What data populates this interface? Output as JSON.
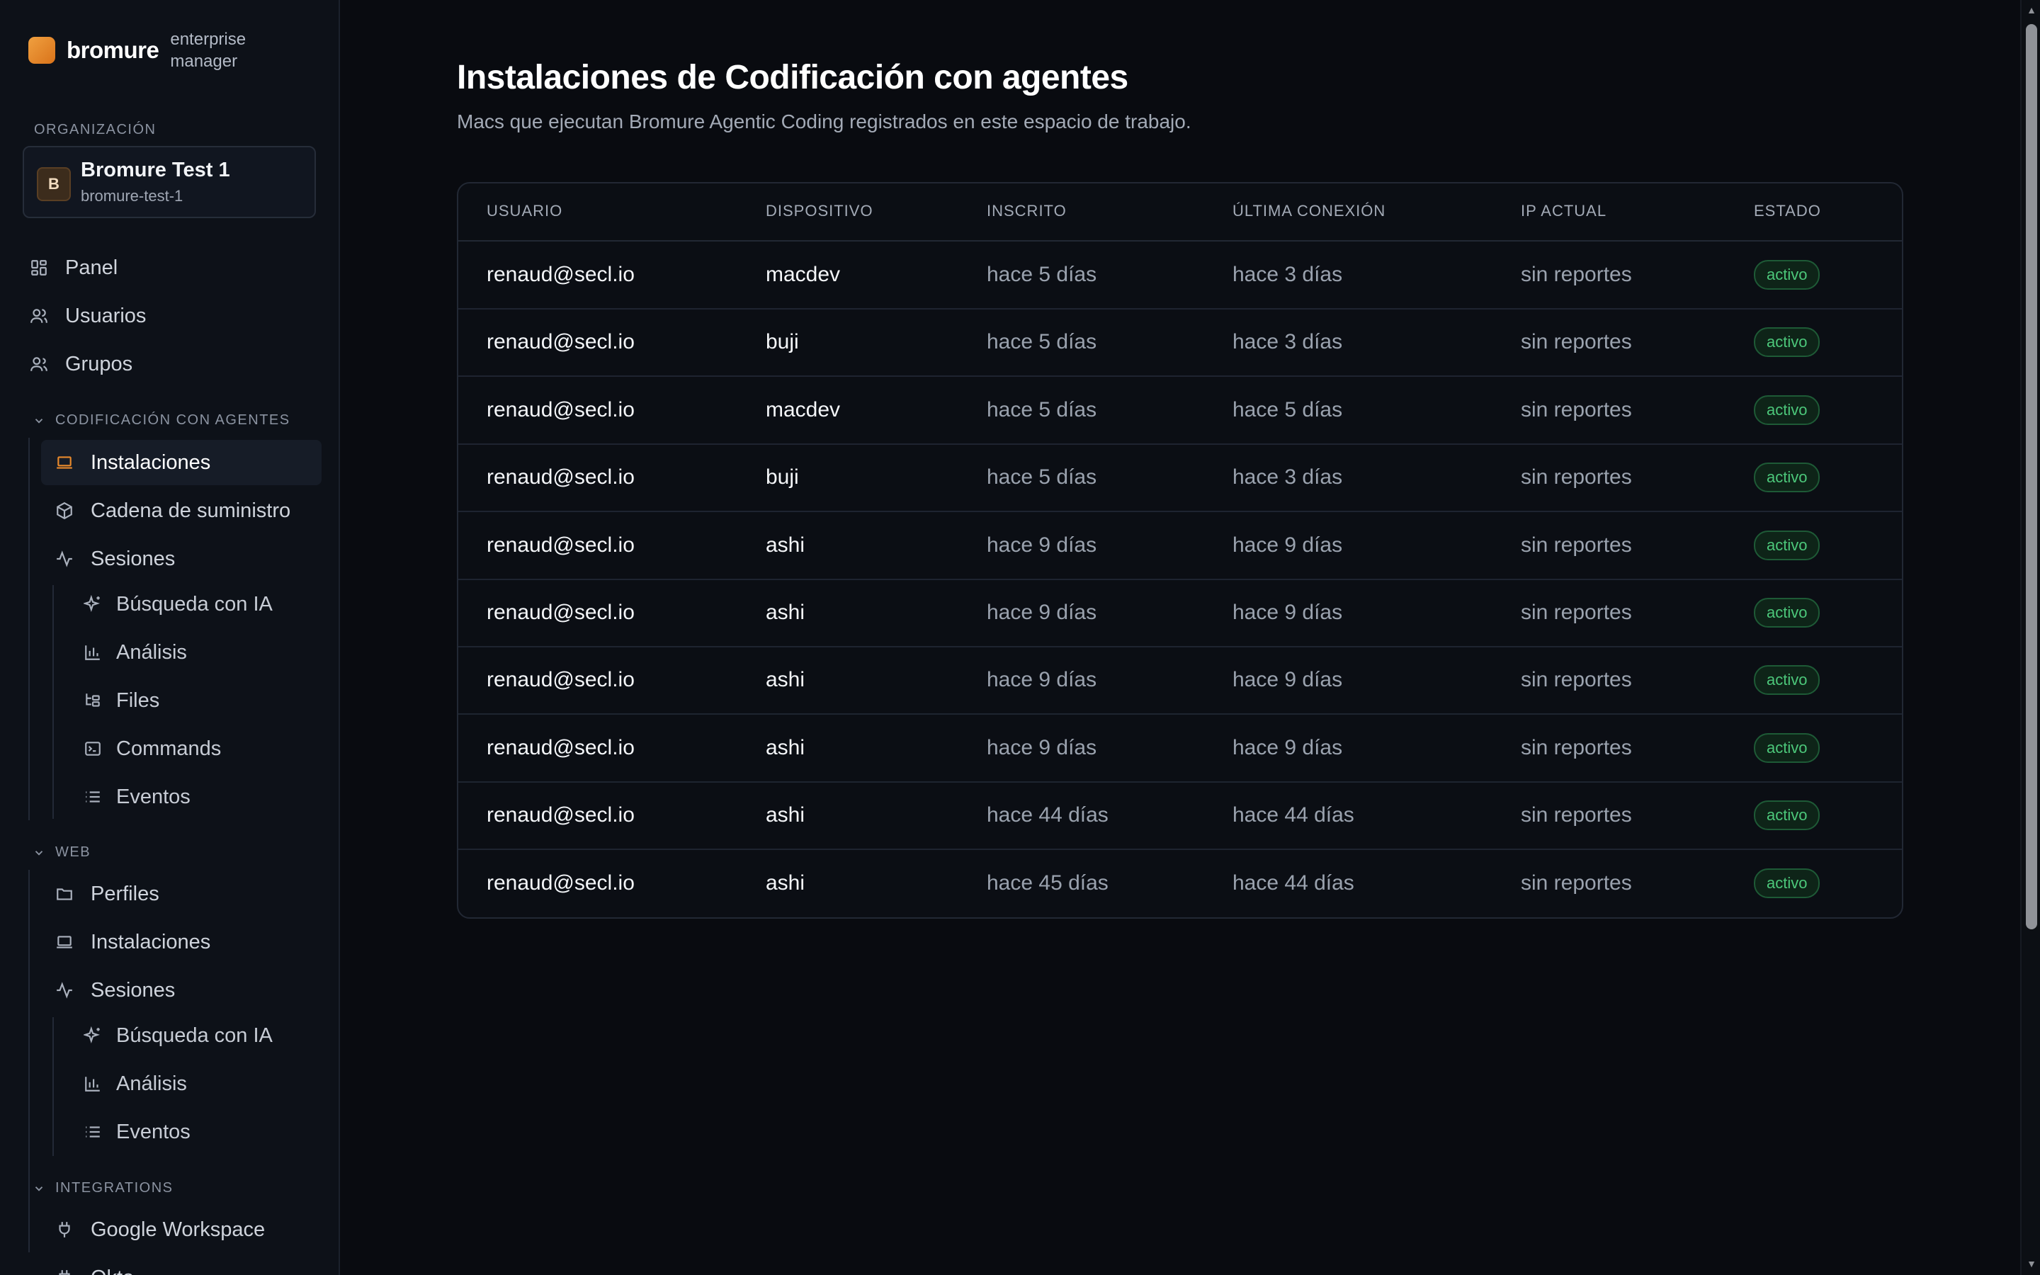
{
  "brand": {
    "name": "bromure",
    "subtitle": "enterprise manager"
  },
  "sidebar": {
    "org_label": "ORGANIZACIÓN",
    "org": {
      "initial": "B",
      "name": "Bromure Test 1",
      "slug": "bromure-test-1"
    },
    "top_items": [
      {
        "label": "Panel",
        "icon": "dashboard-icon"
      },
      {
        "label": "Usuarios",
        "icon": "users-icon"
      },
      {
        "label": "Grupos",
        "icon": "groups-icon"
      }
    ],
    "agent_section": {
      "label": "CODIFICACIÓN CON AGENTES",
      "items": [
        {
          "label": "Instalaciones",
          "icon": "laptop-icon",
          "active": true
        },
        {
          "label": "Cadena de suministro",
          "icon": "package-icon"
        },
        {
          "label": "Sesiones",
          "icon": "activity-icon"
        }
      ],
      "sub_items": [
        {
          "label": "Búsqueda con IA",
          "icon": "sparkles-icon"
        },
        {
          "label": "Análisis",
          "icon": "bar-chart-icon"
        },
        {
          "label": "Files",
          "icon": "folder-tree-icon"
        },
        {
          "label": "Commands",
          "icon": "terminal-icon"
        },
        {
          "label": "Eventos",
          "icon": "list-icon"
        }
      ]
    },
    "web_section": {
      "label": "WEB",
      "items": [
        {
          "label": "Perfiles",
          "icon": "folder-icon"
        },
        {
          "label": "Instalaciones",
          "icon": "laptop-icon"
        },
        {
          "label": "Sesiones",
          "icon": "activity-icon"
        }
      ],
      "sub_items": [
        {
          "label": "Búsqueda con IA",
          "icon": "sparkles-icon"
        },
        {
          "label": "Análisis",
          "icon": "bar-chart-icon"
        },
        {
          "label": "Eventos",
          "icon": "list-icon"
        }
      ]
    },
    "integrations_section": {
      "label": "INTEGRATIONS",
      "items": [
        {
          "label": "Google Workspace",
          "icon": "plug-icon"
        },
        {
          "label": "Okta",
          "icon": "plug-icon"
        }
      ]
    }
  },
  "main": {
    "title": "Instalaciones de Codificación con agentes",
    "subtitle": "Macs que ejecutan Bromure Agentic Coding registrados en este espacio de trabajo.",
    "columns": [
      "USUARIO",
      "DISPOSITIVO",
      "INSCRITO",
      "ÚLTIMA CONEXIÓN",
      "IP ACTUAL",
      "ESTADO"
    ],
    "rows": [
      [
        "renaud@secl.io",
        "macdev",
        "hace 5 días",
        "hace 3 días",
        "sin reportes",
        "activo"
      ],
      [
        "renaud@secl.io",
        "buji",
        "hace 5 días",
        "hace 3 días",
        "sin reportes",
        "activo"
      ],
      [
        "renaud@secl.io",
        "macdev",
        "hace 5 días",
        "hace 5 días",
        "sin reportes",
        "activo"
      ],
      [
        "renaud@secl.io",
        "buji",
        "hace 5 días",
        "hace 3 días",
        "sin reportes",
        "activo"
      ],
      [
        "renaud@secl.io",
        "ashi",
        "hace 9 días",
        "hace 9 días",
        "sin reportes",
        "activo"
      ],
      [
        "renaud@secl.io",
        "ashi",
        "hace 9 días",
        "hace 9 días",
        "sin reportes",
        "activo"
      ],
      [
        "renaud@secl.io",
        "ashi",
        "hace 9 días",
        "hace 9 días",
        "sin reportes",
        "activo"
      ],
      [
        "renaud@secl.io",
        "ashi",
        "hace 9 días",
        "hace 9 días",
        "sin reportes",
        "activo"
      ],
      [
        "renaud@secl.io",
        "ashi",
        "hace 44 días",
        "hace 44 días",
        "sin reportes",
        "activo"
      ],
      [
        "renaud@secl.io",
        "ashi",
        "hace 45 días",
        "hace 44 días",
        "sin reportes",
        "activo"
      ]
    ]
  },
  "colors": {
    "background": "#090b10",
    "sidebar": "#0d1118",
    "accent_orange": "#e8892c",
    "status_green": "#4cc77a"
  }
}
